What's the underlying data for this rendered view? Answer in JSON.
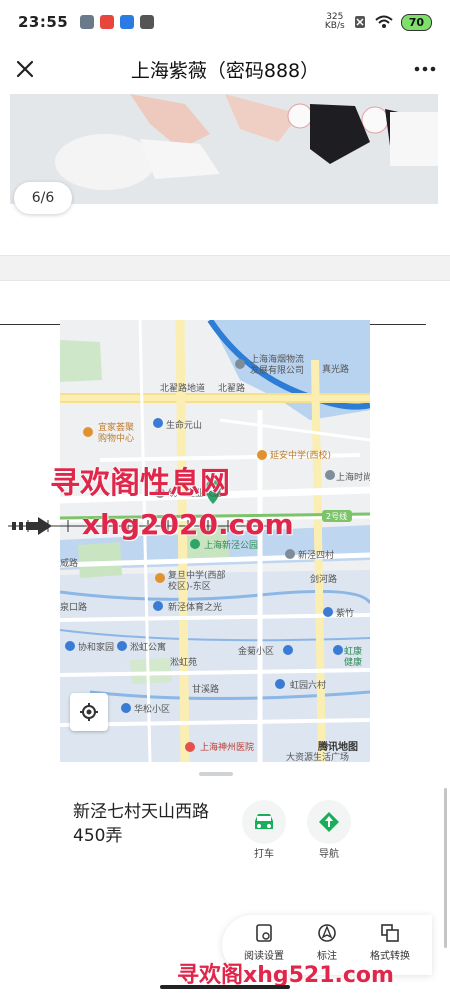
{
  "status_bar": {
    "time": "23:55",
    "speed_value": "325",
    "speed_unit": "KB/s",
    "battery": "70"
  },
  "header": {
    "title": "上海紫薇（密码888）"
  },
  "gallery": {
    "page_indicator": "6/6"
  },
  "map": {
    "labels": {
      "tobacco": "上海海烟物流\n发展有限公司",
      "beizhai_road": "北翟路地道",
      "beizhai": "北翟路",
      "yijia": "宜家荟聚\n购物中心",
      "life_yuanshan": "生命元山",
      "yanan": "延安中学(西校)",
      "shanghai_fashion": "上海时尚",
      "tongyi": "统一企业大厦",
      "line2": "2号线",
      "xinjing_park": "上海新泾公园",
      "xinjing4": "新泾四村",
      "jianhe_road": "剑河路",
      "fudan_school": "复旦中学(西部\n校区)-东区",
      "xinjing_sports": "新泾体育之光",
      "ziyun": "紫竹",
      "jinju": "金菊小区",
      "hongkang": "虹康\n健康",
      "weihong_apt": "淞虹公寓",
      "weihong_yuan": "淞虹苑",
      "xiehe": "协和家园",
      "ganxi": "甘溪路",
      "hongyuan6": "虹园六村",
      "huasong": "华松小区",
      "shenzhou_hospital": "上海神州医院",
      "dazi": "大资源生活广场",
      "tencent": "腾讯地图",
      "quankou": "泉口路",
      "weilu": "威路",
      "zhenguang": "真光路"
    }
  },
  "location": {
    "line1": "新泾七村天山西路",
    "line2": "450弄"
  },
  "actions": {
    "taxi": "打车",
    "navigate": "导航"
  },
  "toolbar": {
    "read_settings": "阅读设置",
    "annotate": "标注",
    "format": "格式转换"
  },
  "watermarks": {
    "site_name": "寻欢阁性息网",
    "domain1": "xhg2020.com",
    "domain2": "寻欢阁xhg521.com"
  },
  "colors": {
    "taxi_green": "#1aad5a",
    "nav_green": "#1aad5a",
    "watermark_red": "#e0264a"
  }
}
